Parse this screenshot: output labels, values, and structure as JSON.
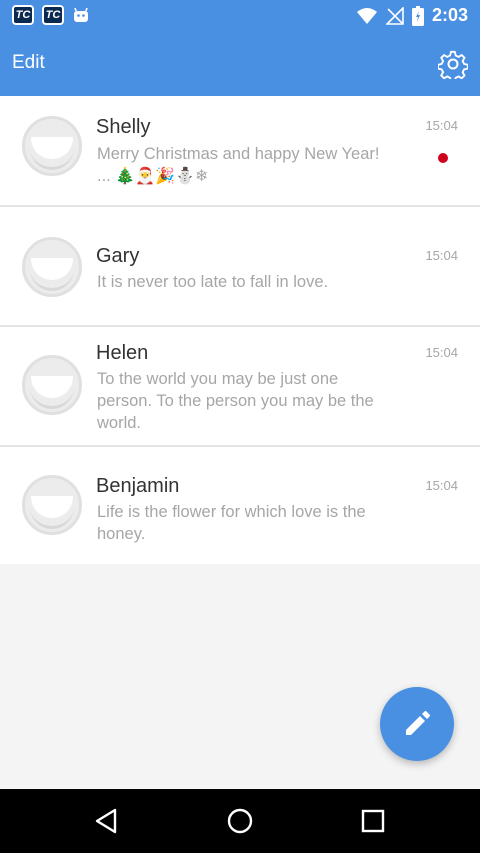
{
  "status_bar": {
    "left_icons": [
      "tc-app-icon",
      "tc-app-icon",
      "android-icon"
    ],
    "tc_label": "TC",
    "right_icons": [
      "wifi-icon",
      "signal-icon",
      "battery-icon"
    ],
    "time": "2:03"
  },
  "app_bar": {
    "edit_label": "Edit",
    "settings_icon": "gear-icon",
    "color": "#4a90e2"
  },
  "conversations": [
    {
      "name": "Shelly",
      "time": "15:04",
      "message": "Merry Christmas and happy New Year! ...",
      "emoji": "🎄🎅🎉⛄❄",
      "unread": true
    },
    {
      "name": "Gary",
      "time": "15:04",
      "message": "It is never too late to fall in love.",
      "unread": false
    },
    {
      "name": "Helen",
      "time": "15:04",
      "message": "To the world you may be just one person. To the person you may be the world.",
      "unread": false
    },
    {
      "name": "Benjamin",
      "time": "15:04",
      "message": "Life is the flower for which love is the honey.",
      "unread": false
    }
  ],
  "fab": {
    "icon": "pencil-icon"
  },
  "nav_bar": {
    "icons": [
      "back-icon",
      "home-icon",
      "recents-icon"
    ]
  },
  "colors": {
    "accent": "#4a90e2",
    "unread_dot": "#d0021b"
  }
}
